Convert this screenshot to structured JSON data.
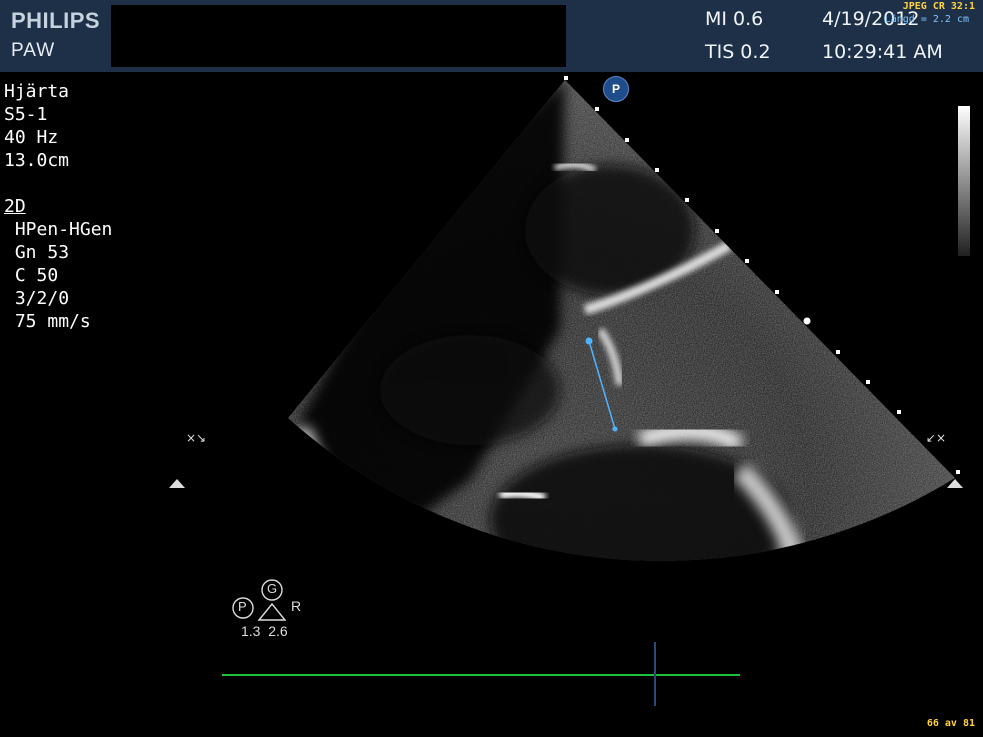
{
  "header": {
    "brand": "PHILIPS",
    "site": "PAW",
    "mi": "MI 0.6",
    "tis": "TIS 0.2",
    "date": "4/19/2012",
    "time": "10:29:41 AM"
  },
  "overlay": {
    "compression": "JPEG CR 32:1",
    "measurement_label": "Längd = 2.2 cm",
    "frame_counter": "66 av 81"
  },
  "params": {
    "preset": "Hjärta",
    "probe": "S5-1",
    "frame_rate": "40 Hz",
    "depth": "13.0cm",
    "mode": "2D",
    "freq": "HPen-HGen",
    "gain": "Gn 53",
    "compress": "C 50",
    "persistence": "3/2/0",
    "sweep": "75 mm/s"
  },
  "orientation": {
    "p_marker": "P",
    "g_marker": "G",
    "r_marker": "R",
    "values": "1.3  2.6"
  },
  "colors": {
    "header_bg": "#1e3048",
    "measurement": "#4fb4ff",
    "ecg": "#1fbf3a",
    "overlay_text": "#ffd23c"
  }
}
